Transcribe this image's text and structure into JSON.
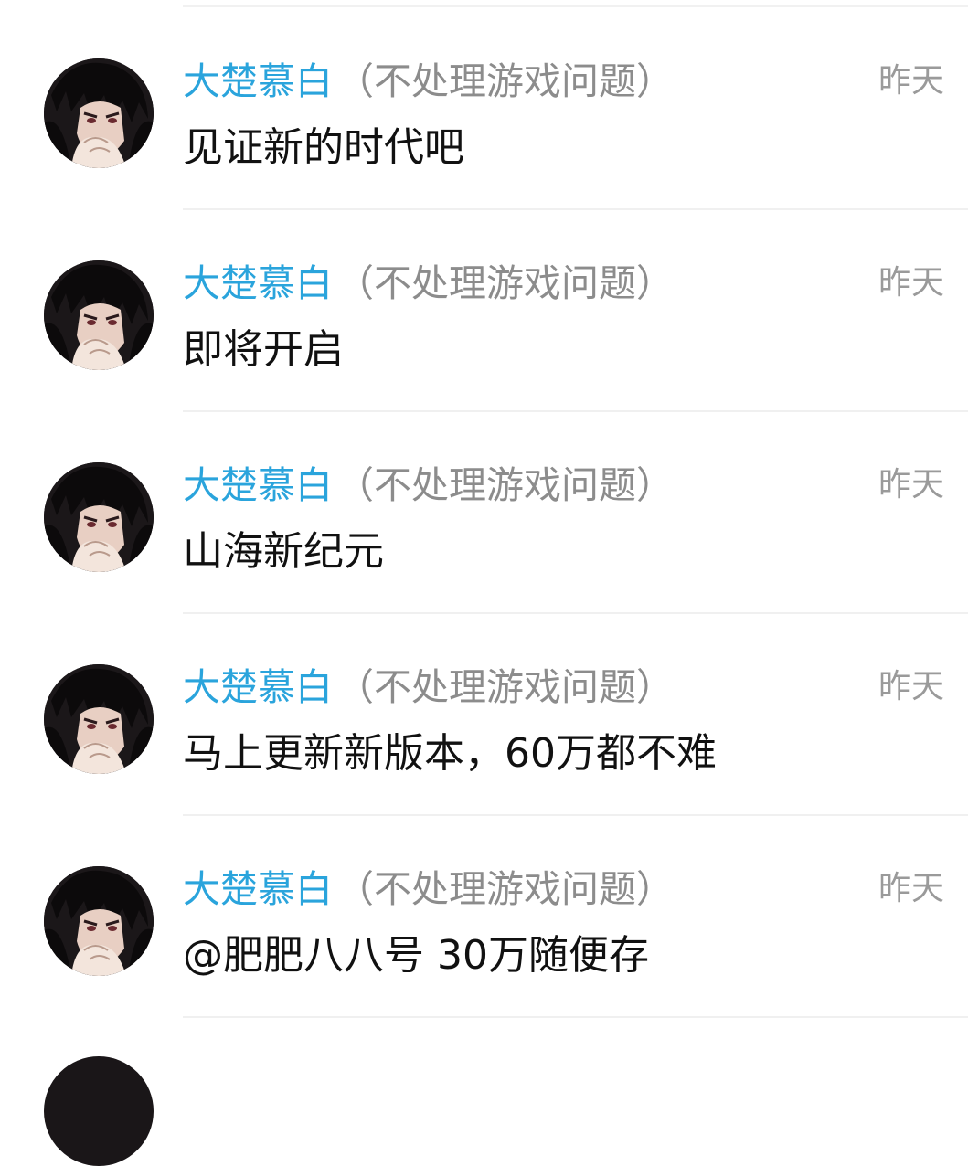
{
  "messages": [
    {
      "sender": "大楚慕白",
      "sender_note": "（不处理游戏问题）",
      "time": "昨天",
      "text": "见证新的时代吧",
      "avatar_icon": "anime-portrait-avatar-icon"
    },
    {
      "sender": "大楚慕白",
      "sender_note": "（不处理游戏问题）",
      "time": "昨天",
      "text": "即将开启",
      "avatar_icon": "anime-portrait-avatar-icon"
    },
    {
      "sender": "大楚慕白",
      "sender_note": "（不处理游戏问题）",
      "time": "昨天",
      "text": "山海新纪元",
      "avatar_icon": "anime-portrait-avatar-icon"
    },
    {
      "sender": "大楚慕白",
      "sender_note": "（不处理游戏问题）",
      "time": "昨天",
      "text": "马上更新新版本，60万都不难",
      "avatar_icon": "anime-portrait-avatar-icon"
    },
    {
      "sender": "大楚慕白",
      "sender_note": "（不处理游戏问题）",
      "time": "昨天",
      "text": "@肥肥八八号 30万随便存",
      "avatar_icon": "anime-portrait-avatar-icon"
    }
  ],
  "colors": {
    "sender_name": "#2aa4dc",
    "sender_note": "#8c8c8c",
    "timestamp": "#9a9a9a",
    "message_text": "#111111",
    "divider": "#f0f0f0"
  }
}
